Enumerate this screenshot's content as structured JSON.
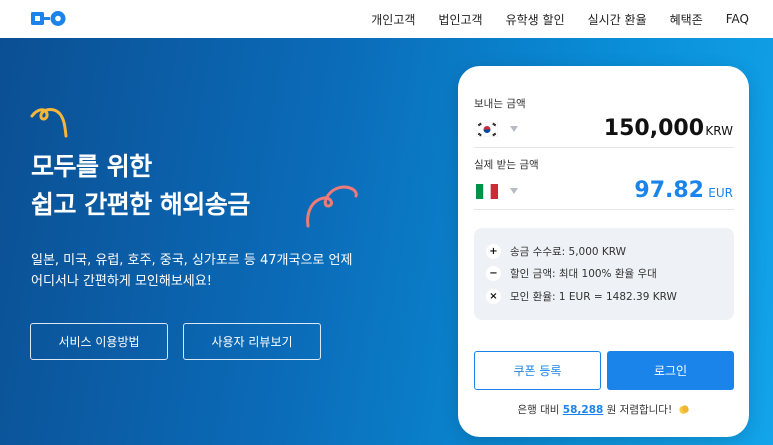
{
  "header": {
    "nav": [
      "개인고객",
      "법인고객",
      "유학생 할인",
      "실시간 환율",
      "혜택존",
      "FAQ"
    ]
  },
  "hero": {
    "headline_line1": "모두를 위한",
    "headline_line2": "쉽고 간편한 해외송금",
    "subtext_line1": "일본, 미국, 유럽, 호주, 중국, 싱가포르 등 47개국으로 언제",
    "subtext_line2": "어디서나 간편하게 모인해보세요!",
    "btn_guide": "서비스 이용방법",
    "btn_review": "사용자 리뷰보기"
  },
  "card": {
    "send_label": "보내는 금액",
    "send_amount": "150,000",
    "send_currency": "KRW",
    "send_flag": "korea-flag-icon",
    "recv_label": "실제 받는 금액",
    "recv_amount": "97.82",
    "recv_currency": "EUR",
    "recv_flag": "italy-flag-icon",
    "fees": [
      {
        "icon": "+",
        "text": "송금 수수료: 5,000 KRW"
      },
      {
        "icon": "−",
        "text": "할인 금액: 최대 100% 환율 우대"
      },
      {
        "icon": "×",
        "text": "모인 환율: 1 EUR = 1482.39 KRW"
      }
    ],
    "btn_coupon": "쿠폰 등록",
    "btn_login": "로그인",
    "savings_prefix": "은행 대비",
    "savings_amount": "58,288",
    "savings_suffix": "원 저렴합니다!"
  },
  "colors": {
    "accent": "#1a84ea",
    "hero_start": "#0b4f93",
    "hero_end": "#13a4ea",
    "swirl_yellow": "#f5b63a",
    "swirl_pink": "#f07a78"
  }
}
